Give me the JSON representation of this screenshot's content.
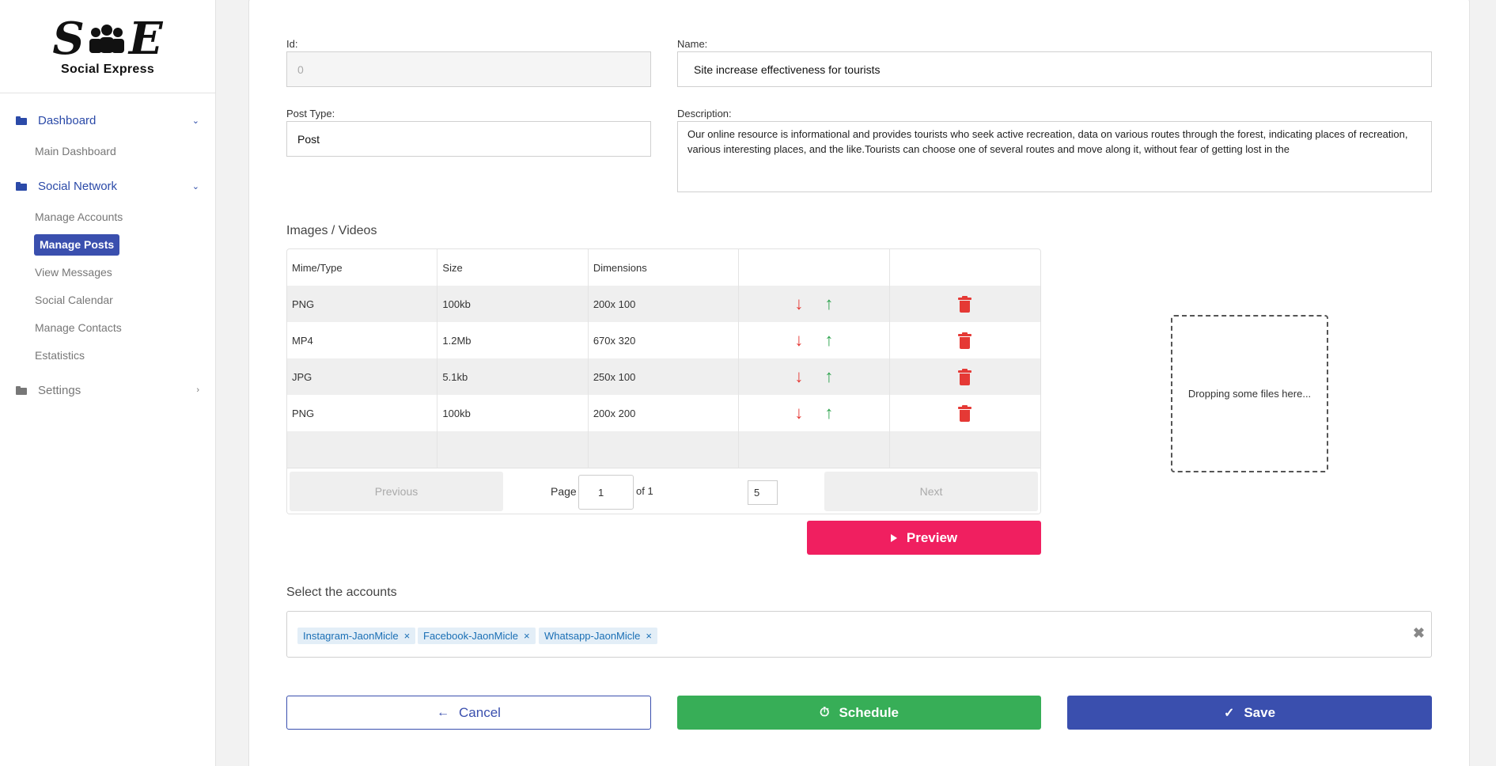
{
  "brand": {
    "logo_left": "S",
    "logo_right": "E",
    "name": "Social Express"
  },
  "sidebar": {
    "groups": [
      {
        "label": "Dashboard",
        "items": [
          {
            "label": "Main Dashboard"
          }
        ]
      },
      {
        "label": "Social Network",
        "items": [
          {
            "label": "Manage Accounts"
          },
          {
            "label": "Manage Posts",
            "active": true
          },
          {
            "label": "View Messages"
          },
          {
            "label": "Social Calendar"
          },
          {
            "label": "Manage Contacts"
          },
          {
            "label": "Estatistics"
          }
        ]
      },
      {
        "label": "Settings",
        "items": []
      }
    ]
  },
  "form": {
    "id_label": "Id:",
    "id_value": "0",
    "name_label": "Name:",
    "name_value": "Site increase effectiveness for tourists",
    "post_type_label": "Post Type:",
    "post_type_value": "Post",
    "description_label": "Description:",
    "description_value": "Our online resource is informational and provides tourists who seek active recreation, data on various routes through the forest, indicating places of recreation, various interesting places, and the like.Tourists can choose one of several routes and move along it, without fear of getting lost in the"
  },
  "media": {
    "title": "Images / Videos",
    "columns": [
      "Mime/Type",
      "Size",
      "Dimensions",
      "",
      ""
    ],
    "rows": [
      {
        "type": "PNG",
        "size": "100kb",
        "dimensions": "200x 100"
      },
      {
        "type": "MP4",
        "size": "1.2Mb",
        "dimensions": "670x 320"
      },
      {
        "type": "JPG",
        "size": "5.1kb",
        "dimensions": "250x 100"
      },
      {
        "type": "PNG",
        "size": "100kb",
        "dimensions": "200x 200"
      }
    ],
    "pager": {
      "previous": "Previous",
      "next": "Next",
      "page_label": "Page",
      "page_value": "1",
      "of_label": "of 1",
      "page_size": "5"
    },
    "preview_label": "Preview",
    "dropzone_text": "Dropping some files here..."
  },
  "accounts": {
    "title": "Select the accounts",
    "selected": [
      "Instagram-JaonMicle",
      "Facebook-JaonMicle",
      "Whatsapp-JaonMicle"
    ],
    "remove_glyph": "×",
    "clear_glyph": "✖"
  },
  "actions": {
    "cancel": "Cancel",
    "schedule": "Schedule",
    "save": "Save"
  },
  "colors": {
    "primary": "#3a4fae",
    "preview": "#f01f60",
    "schedule": "#37ae57",
    "danger": "#e53935",
    "up_arrow": "#2fa44f"
  },
  "icons": {
    "down": "↓",
    "up": "↑",
    "cancel": "←",
    "schedule": "⏱",
    "save": "✓"
  }
}
